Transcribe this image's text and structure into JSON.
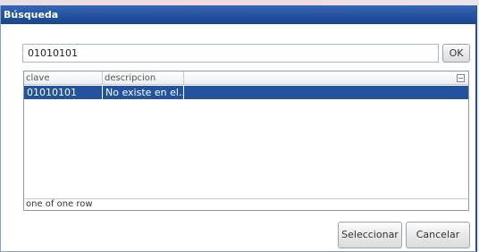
{
  "dialog": {
    "title": "Búsqueda"
  },
  "search": {
    "value": "01010101",
    "ok_label": "OK"
  },
  "grid": {
    "columns": [
      "clave",
      "descripcion"
    ],
    "rows": [
      {
        "clave": "01010101",
        "descripcion": "No existe en el..."
      }
    ],
    "footer": "one of one row",
    "selected_row_color": "#23529f"
  },
  "buttons": {
    "select_label": "Seleccionar",
    "cancel_label": "Cancelar"
  },
  "theme": {
    "titlebar_color": "#24539f"
  }
}
